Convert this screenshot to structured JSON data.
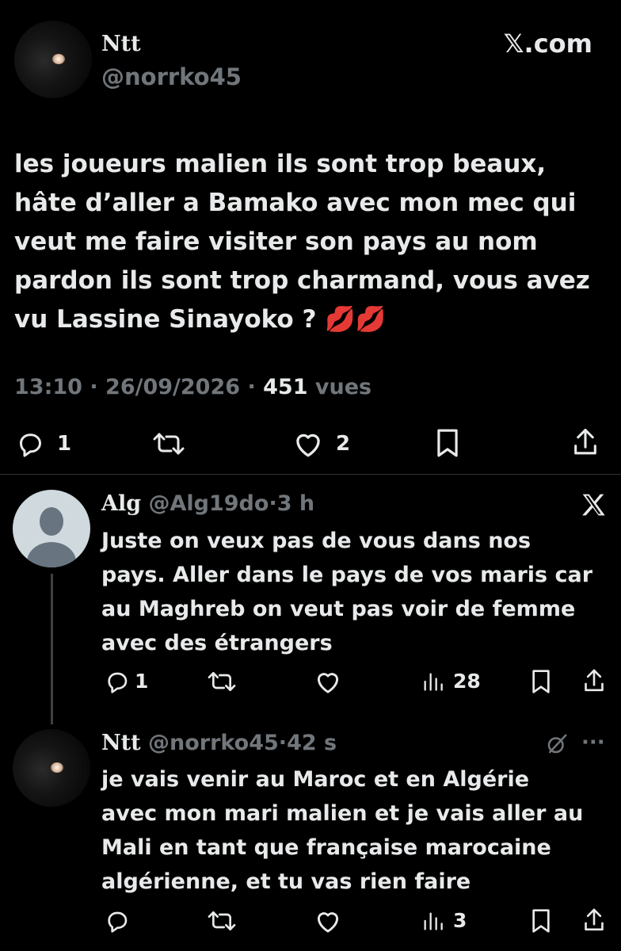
{
  "main_tweet": {
    "author_name": "Ntt",
    "handle": "@norrko45",
    "brand": "𝕏.com",
    "text_lines": [
      "les joueurs malien ils sont trop beaux,",
      "hâte d’aller a Bamako avec mon mec qui",
      "veut me faire visiter son pays au nom",
      "pardon ils sont trop charmand, vous avez",
      "vu Lassine Sinayoko ? 💋💋"
    ],
    "time": "13:10",
    "sep": "·",
    "date": "26/09/2026",
    "views_count": "451",
    "views_label": "vues",
    "replies": "1",
    "likes": "2"
  },
  "reply1": {
    "author_name": "Alg",
    "handle": "@Alg19do",
    "time": "3 h",
    "text_lines": [
      "Juste on veux pas de vous dans nos",
      "pays. Aller dans le pays de vos maris car",
      "au Maghreb on veut pas voir de femme",
      "avec des étrangers"
    ],
    "replies": "1",
    "views": "28"
  },
  "reply2": {
    "author_name": "Ntt",
    "handle": "@norrko45",
    "time": "42 s",
    "more": "···",
    "text_lines": [
      "je vais venir au Maroc et en Algérie",
      "avec mon mari malien et je vais aller au",
      "Mali en tant que française marocaine",
      "algérienne, et tu vas rien faire"
    ],
    "views": "3"
  },
  "colors": {
    "background": "#000000",
    "text": "#e7e9ea",
    "muted": "#71767b",
    "divider": "#2f3336"
  }
}
